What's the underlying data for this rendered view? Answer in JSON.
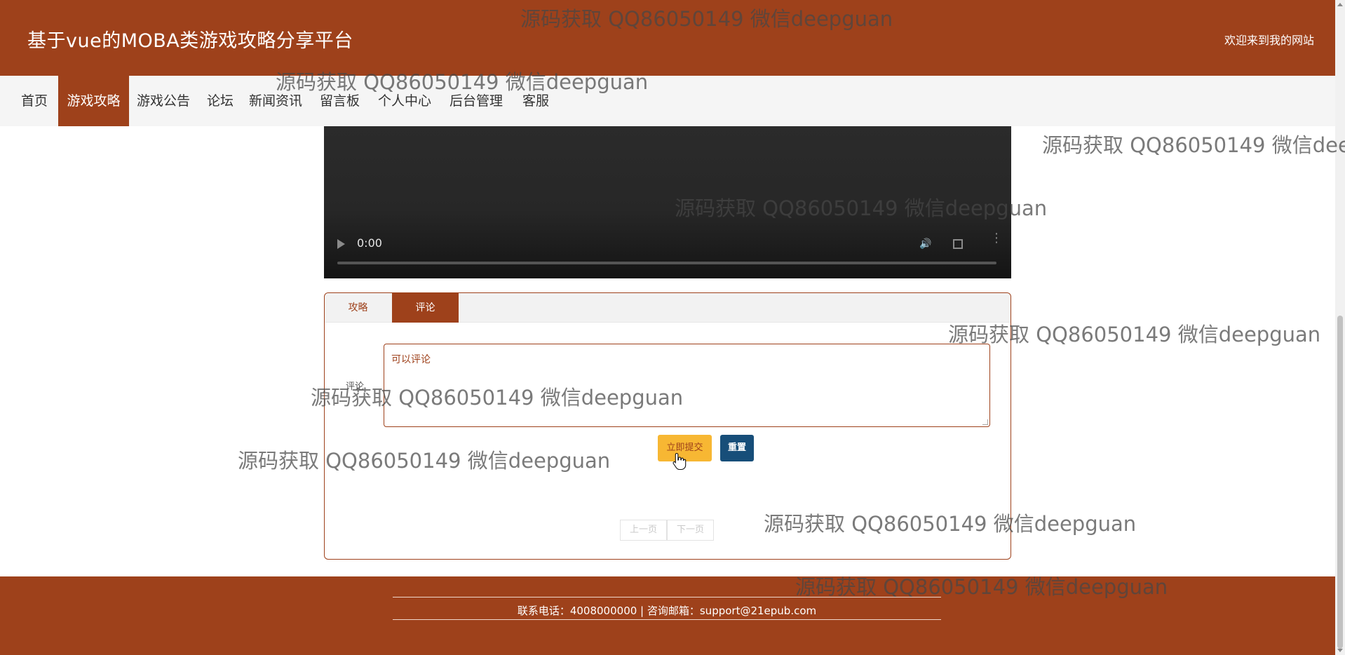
{
  "header": {
    "site_title": "基于vue的MOBA类游戏攻略分享平台",
    "welcome": "欢迎来到我的网站"
  },
  "nav": {
    "items": [
      "首页",
      "游戏攻略",
      "游戏公告",
      "论坛",
      "新闻资讯",
      "留言板",
      "个人中心",
      "后台管理",
      "客服"
    ],
    "active": "游戏攻略"
  },
  "video": {
    "current_time": "0:00",
    "progress": 0
  },
  "tabs": {
    "guide": "攻略",
    "comment": "评论",
    "active": "评论"
  },
  "comment_form": {
    "label": "评论",
    "placeholder": "可以评论",
    "submit_label": "立即提交",
    "reset_label": "重置"
  },
  "pager": {
    "prev": "上一页",
    "next": "下一页"
  },
  "footer": {
    "contact": "联系电话：4008000000 | 咨询邮箱：support@21epub.com"
  },
  "watermark": "源码获取 QQ86050149 微信deepguan",
  "colors": {
    "brand": "#9e411b",
    "submit_button": "#f7b733",
    "reset_button": "#174e79",
    "nav_background": "#f5f5f5"
  },
  "icons": [
    "play-icon",
    "volume-icon",
    "fullscreen-icon",
    "more-icon",
    "hand-cursor-icon"
  ]
}
